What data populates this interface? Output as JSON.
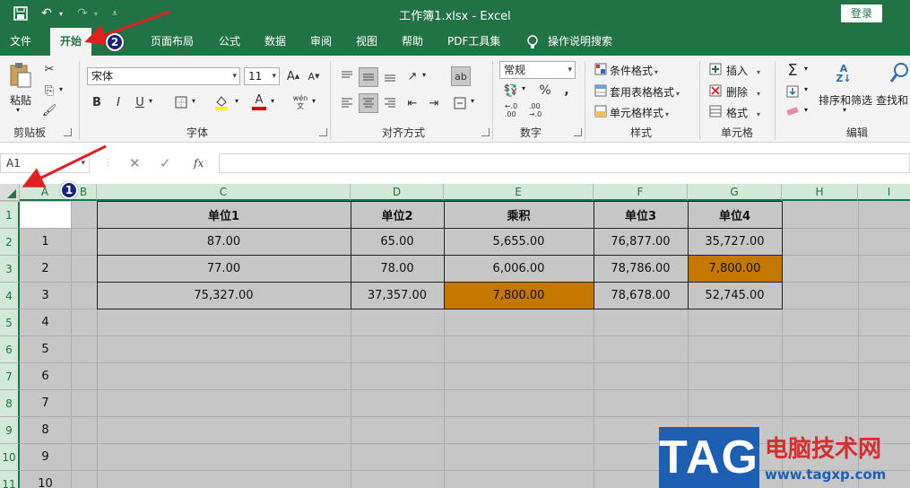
{
  "window": {
    "title": "工作簿1.xlsx  -  Excel",
    "login_label": "登录"
  },
  "tabs": [
    {
      "label": "文件"
    },
    {
      "label": "开始",
      "active": true
    },
    {
      "label": "页面布局"
    },
    {
      "label": "公式"
    },
    {
      "label": "数据"
    },
    {
      "label": "审阅"
    },
    {
      "label": "视图"
    },
    {
      "label": "帮助"
    },
    {
      "label": "PDF工具集"
    },
    {
      "label": "操作说明搜索"
    }
  ],
  "ribbon": {
    "clipboard": {
      "paste_label": "粘贴",
      "group_label": "剪贴板"
    },
    "font": {
      "font_name": "宋体",
      "font_size": "11",
      "group_label": "字体",
      "wen_label": "wén\n文"
    },
    "alignment": {
      "group_label": "对齐方式"
    },
    "number": {
      "format": "常规",
      "group_label": "数字"
    },
    "styles": {
      "conditional": "条件格式",
      "table_format": "套用表格格式",
      "cell_style": "单元格样式",
      "group_label": "样式"
    },
    "cells": {
      "insert": "插入",
      "delete": "删除",
      "format": "格式",
      "group_label": "单元格"
    },
    "editing": {
      "sort_filter": "排序和筛选",
      "find_select": "查找和",
      "group_label": "编辑"
    }
  },
  "formula_bar": {
    "name_box": "A1",
    "fx": "fx",
    "value": ""
  },
  "sheet": {
    "columns": [
      "A",
      "B",
      "C",
      "D",
      "E",
      "F",
      "G",
      "H",
      "I"
    ],
    "rows": [
      "1",
      "2",
      "3",
      "4",
      "5",
      "6",
      "7",
      "8",
      "9",
      "10",
      "11"
    ],
    "table_headers": [
      "单位1",
      "单位2",
      "乘积",
      "单位3",
      "单位4"
    ],
    "a_column": [
      "",
      "1",
      "2",
      "3",
      "4",
      "5",
      "6",
      "7",
      "8",
      "9",
      "10"
    ],
    "table_rows": [
      [
        "87.00",
        "65.00",
        "5,655.00",
        "76,877.00",
        "35,727.00"
      ],
      [
        "77.00",
        "78.00",
        "6,006.00",
        "78,786.00",
        "7,800.00"
      ],
      [
        "75,327.00",
        "37,357.00",
        "7,800.00",
        "78,678.00",
        "52,745.00"
      ]
    ],
    "highlight_color": "#c57800"
  },
  "annotations": {
    "badge1": "1",
    "badge2": "2",
    "arrow_color": "#e02020"
  },
  "watermark": {
    "logo": "TAG",
    "title": "电脑技术网",
    "url": "www.tagxp.com"
  },
  "colors": {
    "accent": "#217346",
    "selected_bg": "#c6c6c6"
  }
}
